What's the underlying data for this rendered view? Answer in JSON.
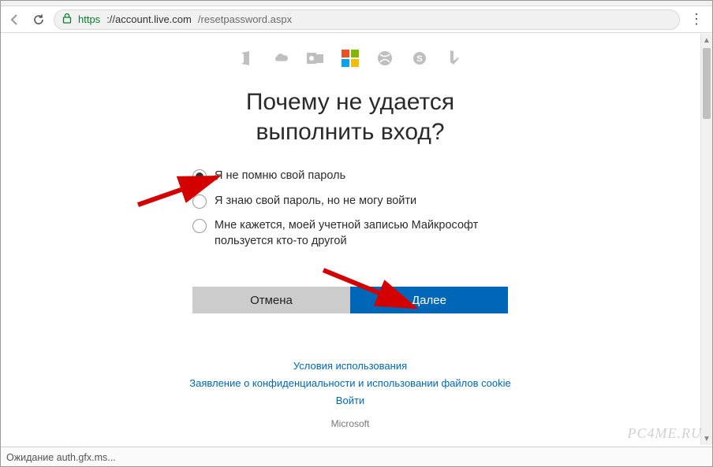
{
  "browser": {
    "url_scheme": "https",
    "url_host": "://account.live.com",
    "url_path": "/resetpassword.aspx",
    "status_text": "Ожидание auth.gfx.ms..."
  },
  "product_icons": [
    "office-icon",
    "onedrive-icon",
    "outlook-icon",
    "microsoft-logo",
    "xbox-icon",
    "skype-icon",
    "bing-icon"
  ],
  "heading_line1": "Почему не удается",
  "heading_line2": "выполнить вход?",
  "options": [
    {
      "label": "Я не помню свой пароль",
      "checked": true
    },
    {
      "label": "Я знаю свой пароль, но не могу войти",
      "checked": false
    },
    {
      "label": "Мне кажется, моей учетной записью Майкрософт пользуется кто-то другой",
      "checked": false
    }
  ],
  "buttons": {
    "cancel": "Отмена",
    "next": "Далее"
  },
  "footer": {
    "terms": "Условия использования",
    "privacy": "Заявление о конфиденциальности и использовании файлов cookie",
    "signin": "Войти",
    "brand": "Microsoft"
  },
  "watermark": "PC4ME.RU"
}
